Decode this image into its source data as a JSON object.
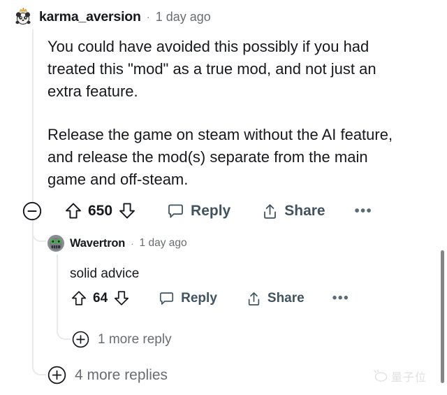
{
  "top_comment": {
    "avatar": "panda-crown-avatar",
    "username": "karma_aversion",
    "separator": "·",
    "timestamp": "1 day ago",
    "paragraph_1": "You could have avoided this possibly if you had\ntreated this \"mod\" as a true mod, and not just an\nextra feature.",
    "paragraph_2": "Release the game on steam without the AI feature,\nand release the mod(s) separate from the main\ngame and off-steam.",
    "actions": {
      "collapse_icon": "circle-minus-icon",
      "upvote_icon": "upvote-arrow-icon",
      "score": "650",
      "downvote_icon": "downvote-arrow-icon",
      "reply_icon": "comment-bubble-icon",
      "reply_label": "Reply",
      "share_icon": "share-arrow-icon",
      "share_label": "Share",
      "overflow_label": "•••"
    }
  },
  "nested_comment": {
    "avatar": "robot-avatar",
    "username": "Wavertron",
    "separator": "·",
    "timestamp": "1 day ago",
    "body": "solid advice",
    "actions": {
      "upvote_icon": "upvote-arrow-icon",
      "score": "64",
      "downvote_icon": "downvote-arrow-icon",
      "reply_icon": "comment-bubble-icon",
      "reply_label": "Reply",
      "share_icon": "share-arrow-icon",
      "share_label": "Share",
      "overflow_label": "•••"
    }
  },
  "expanders": [
    {
      "icon": "plus-circle-icon",
      "label": "1 more reply"
    },
    {
      "icon": "plus-circle-icon",
      "label": "4 more replies"
    }
  ],
  "watermark": {
    "icon": "qbitai-logo-icon",
    "text": "量子位"
  },
  "scrollbar": {
    "orientation": "vertical"
  },
  "colors": {
    "text_primary": "#16181c",
    "text_muted": "#6a6d70",
    "action_label": "#40535e",
    "thread_line": "#e9eaec",
    "background": "#ffffff",
    "scrollbar_thumb": "#868686"
  }
}
